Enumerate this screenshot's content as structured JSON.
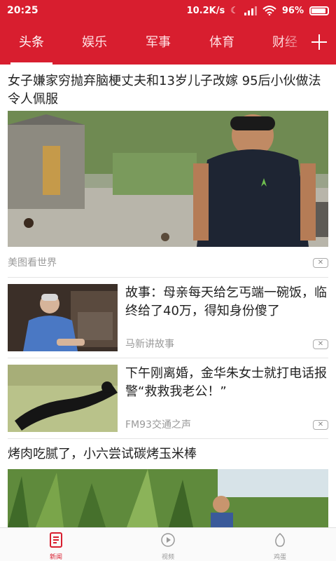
{
  "status_bar": {
    "time": "20:25",
    "network_speed": "10.2K/s",
    "battery": "96%",
    "accent_color": "#d81e2f"
  },
  "tabs": [
    {
      "label": "头条",
      "active": true
    },
    {
      "label": "娱乐",
      "active": false
    },
    {
      "label": "军事",
      "active": false
    },
    {
      "label": "体育",
      "active": false
    },
    {
      "label": "财经",
      "active": false
    }
  ],
  "feed": [
    {
      "type": "large",
      "title": "女子嫌家穷抛弃脑梗丈夫和13岁儿子改嫁 95后小伙做法令人佩服",
      "source": "美图看世界",
      "image": "young man in navy t-shirt standing in rural village yard with chickens"
    },
    {
      "type": "small",
      "title": "故事：母亲每天给乞丐端一碗饭，临终给了40万，得知身份傻了",
      "source": "马新讲故事",
      "image": "elderly woman in blue jacket sitting indoors"
    },
    {
      "type": "small",
      "title": "下午刚离婚，金华朱女士就打电话报警“救救我老公！”",
      "source": "FM93交通之声",
      "image": "person lying face down on a bed"
    },
    {
      "type": "large",
      "title": "烤肉吃腻了，小六尝试碳烤玉米棒",
      "source": "",
      "image": "boy standing in a corn field"
    }
  ],
  "dismiss_symbol": "✕",
  "bottom_nav": [
    {
      "label": "新闻",
      "icon": "news-icon",
      "active": true
    },
    {
      "label": "视频",
      "icon": "video-play-icon",
      "active": false
    },
    {
      "label": "鸡蛋",
      "icon": "egg-icon",
      "active": false
    }
  ]
}
